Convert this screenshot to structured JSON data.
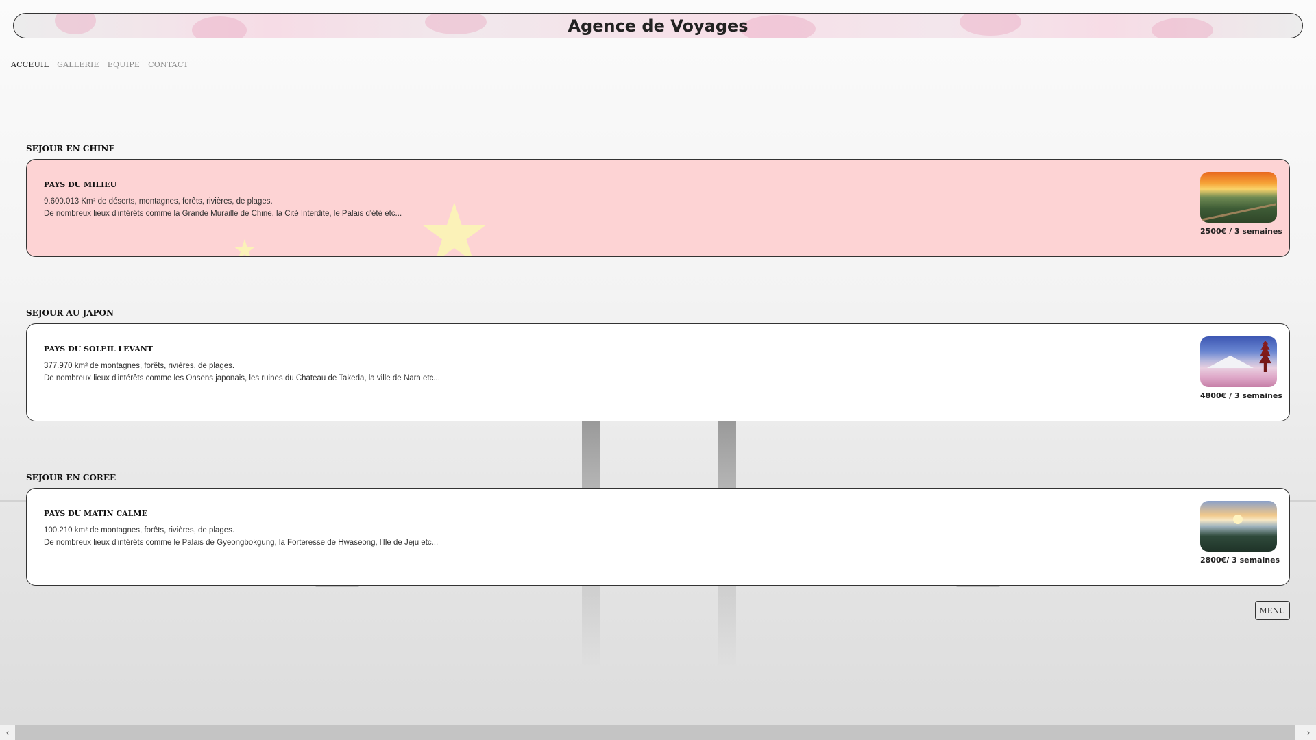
{
  "header": {
    "title": "Agence de Voyages"
  },
  "nav": {
    "items": [
      {
        "label": "ACCEUIL",
        "active": true
      },
      {
        "label": "GALLERIE",
        "active": false
      },
      {
        "label": "EQUIPE",
        "active": false
      },
      {
        "label": "CONTACT",
        "active": false
      }
    ]
  },
  "sections": [
    {
      "title": "SEJOUR EN CHINE",
      "heading": "PAYS DU MILIEU",
      "line1": "9.600.013 Km² de déserts, montagnes, forêts, rivières, de plages.",
      "line2": "De nombreux lieux d'intérêts comme la Grande Muraille de Chine, la Cité Interdite, le Palais d'été etc...",
      "price": "2500€ / 3 semaines",
      "image": "great-wall-sunset-image"
    },
    {
      "title": "SEJOUR AU JAPON",
      "heading": "PAYS DU SOLEIL LEVANT",
      "line1": "377.970 km² de montagnes, forêts, rivières, de plages.",
      "line2": "De nombreux lieux d'intérêts comme les Onsens japonais, les ruines du Chateau de Takeda, la ville de Nara etc...",
      "price": "4800€ / 3 semaines",
      "image": "fuji-pagoda-image"
    },
    {
      "title": "SEJOUR EN COREE",
      "heading": "PAYS DU MATIN CALME",
      "line1": "100.210 km² de montagnes, forêts, rivières, de plages.",
      "line2": "De nombreux lieux d'intérêts comme le Palais de Gyeongbokgung, la Forteresse de Hwaseong, l'Ile de Jeju etc...",
      "price": "2800€/ 3 semaines",
      "image": "coast-sunset-image"
    }
  ],
  "menu_button": {
    "label": "MENU"
  },
  "scrollbar": {
    "left_icon": "chevron-left-icon",
    "right_icon": "chevron-right-icon",
    "left_glyph": "‹",
    "right_glyph": "›"
  },
  "colors": {
    "china_card": "#fdd3d4",
    "star": "#fbf2b8",
    "border": "#333333"
  }
}
